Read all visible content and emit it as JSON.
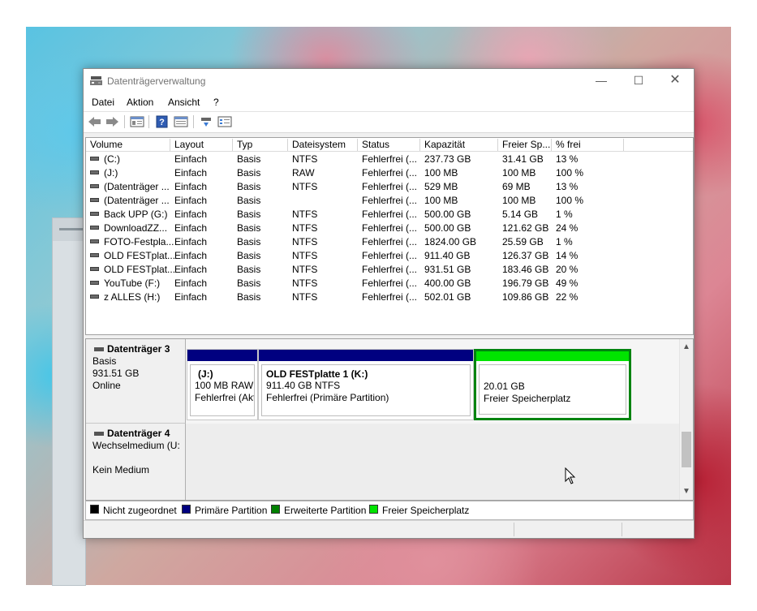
{
  "window": {
    "title": "Datenträgerverwaltung",
    "controls": {
      "minimize": "—",
      "maximize": "☐",
      "close": "✕"
    }
  },
  "menu": [
    "Datei",
    "Aktion",
    "Ansicht",
    "?"
  ],
  "toolbar": {
    "icons": [
      "back-arrow-icon",
      "forward-arrow-icon",
      "properties-view-icon",
      "help-icon",
      "list-view-icon",
      "rescan-icon",
      "settings-icon"
    ]
  },
  "volume_table": {
    "columns": [
      "Volume",
      "Layout",
      "Typ",
      "Dateisystem",
      "Status",
      "Kapazität",
      "Freier Sp...",
      "% frei"
    ],
    "rows": [
      [
        "(C:)",
        "Einfach",
        "Basis",
        "NTFS",
        "Fehlerfrei (...",
        "237.73 GB",
        "31.41 GB",
        "13 %"
      ],
      [
        "(J:)",
        "Einfach",
        "Basis",
        "RAW",
        "Fehlerfrei (...",
        "100 MB",
        "100 MB",
        "100 %"
      ],
      [
        "(Datenträger ...",
        "Einfach",
        "Basis",
        "NTFS",
        "Fehlerfrei (...",
        "529 MB",
        "69 MB",
        "13 %"
      ],
      [
        "(Datenträger ...",
        "Einfach",
        "Basis",
        "",
        "Fehlerfrei (...",
        "100 MB",
        "100 MB",
        "100 %"
      ],
      [
        "Back UPP (G:)",
        "Einfach",
        "Basis",
        "NTFS",
        "Fehlerfrei (...",
        "500.00 GB",
        "5.14 GB",
        "1 %"
      ],
      [
        "DownloadZZ...",
        "Einfach",
        "Basis",
        "NTFS",
        "Fehlerfrei (...",
        "500.00 GB",
        "121.62 GB",
        "24 %"
      ],
      [
        "FOTO-Festpla...",
        "Einfach",
        "Basis",
        "NTFS",
        "Fehlerfrei (...",
        "1824.00 GB",
        "25.59 GB",
        "1 %"
      ],
      [
        "OLD FESTplat...",
        "Einfach",
        "Basis",
        "NTFS",
        "Fehlerfrei (...",
        "911.40 GB",
        "126.37 GB",
        "14 %"
      ],
      [
        "OLD FESTplat...",
        "Einfach",
        "Basis",
        "NTFS",
        "Fehlerfrei (...",
        "931.51 GB",
        "183.46 GB",
        "20 %"
      ],
      [
        "YouTube (F:)",
        "Einfach",
        "Basis",
        "NTFS",
        "Fehlerfrei (...",
        "400.00 GB",
        "196.79 GB",
        "49 %"
      ],
      [
        "z ALLES (H:)",
        "Einfach",
        "Basis",
        "NTFS",
        "Fehlerfrei (...",
        "502.01 GB",
        "109.86 GB",
        "22 %"
      ]
    ]
  },
  "disk3": {
    "name": "Datenträger 3",
    "type": "Basis",
    "size": "931.51 GB",
    "state": "Online",
    "partitions": [
      {
        "title": "(J:)",
        "line1": "100 MB RAW",
        "line2": "Fehlerfrei (Akt",
        "bar_color": "#000080"
      },
      {
        "title": "OLD FESTplatte 1  (K:)",
        "line1": "911.40 GB NTFS",
        "line2": "Fehlerfrei (Primäre Partition)",
        "bar_color": "#000080"
      },
      {
        "title": "",
        "line1": "20.01 GB",
        "line2": "Freier Speicherplatz",
        "bar_color": "#00e400"
      }
    ]
  },
  "disk4": {
    "name": "Datenträger 4",
    "type": "Wechselmedium (U:",
    "state": "Kein Medium"
  },
  "legend": [
    {
      "label": "Nicht zugeordnet",
      "color": "#000000"
    },
    {
      "label": "Primäre Partition",
      "color": "#000080"
    },
    {
      "label": "Erweiterte Partition",
      "color": "#008000"
    },
    {
      "label": "Freier Speicherplatz",
      "color": "#00e400"
    }
  ]
}
